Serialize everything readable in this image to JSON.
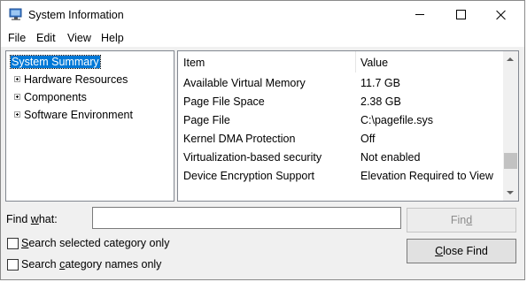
{
  "window": {
    "title": "System Information"
  },
  "menu": [
    "File",
    "Edit",
    "View",
    "Help"
  ],
  "tree": {
    "selected": "System Summary",
    "items": [
      "Hardware Resources",
      "Components",
      "Software Environment"
    ]
  },
  "list": {
    "columns": {
      "item": "Item",
      "value": "Value"
    },
    "rows": [
      {
        "item": "Available Virtual Memory",
        "value": "11.7 GB"
      },
      {
        "item": "Page File Space",
        "value": "2.38 GB"
      },
      {
        "item": "Page File",
        "value": "C:\\pagefile.sys"
      },
      {
        "item": "Kernel DMA Protection",
        "value": "Off"
      },
      {
        "item": "Virtualization-based security",
        "value": "Not enabled"
      },
      {
        "item": "Device Encryption Support",
        "value": "Elevation Required to View"
      }
    ]
  },
  "find": {
    "label_prefix": "Find ",
    "label_hotkey": "w",
    "label_suffix": "hat:",
    "input_value": "",
    "find_button_prefix": "Fin",
    "find_button_hotkey": "d",
    "close_find_hotkey": "C",
    "close_find_suffix": "lose Find",
    "option1_hotkey": "S",
    "option1_suffix": "earch selected category only",
    "option2_prefix": "Search ",
    "option2_hotkey": "c",
    "option2_suffix": "ategory names only",
    "option1_checked": false,
    "option2_checked": false
  },
  "colors": {
    "selection": "#0078d7",
    "window_bg": "#f0f0f0"
  }
}
